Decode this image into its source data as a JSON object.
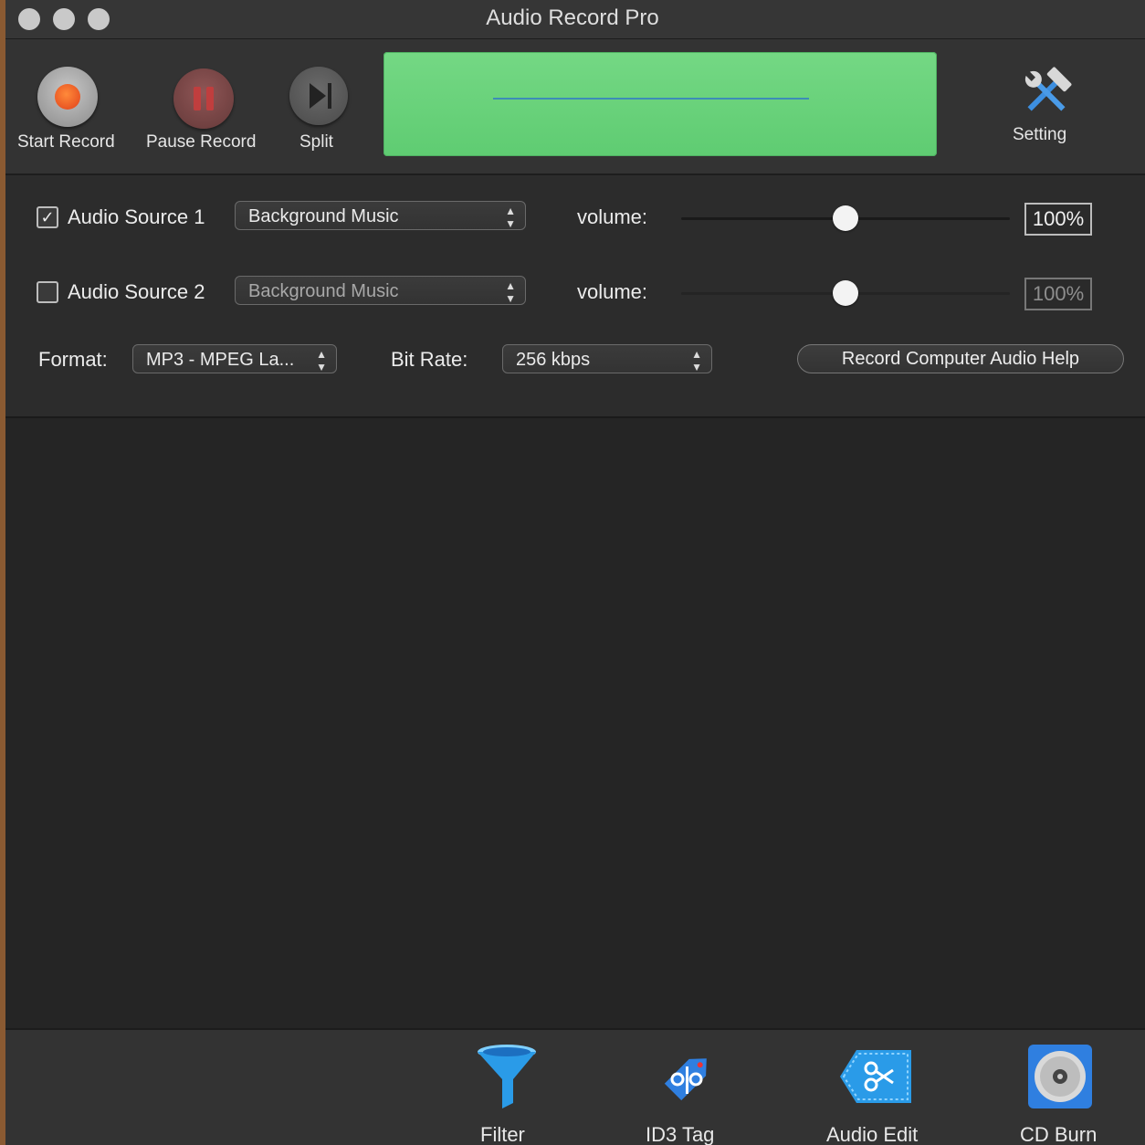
{
  "window": {
    "title": "Audio Record Pro"
  },
  "toolbar": {
    "start_record": "Start Record",
    "pause_record": "Pause Record",
    "split": "Split",
    "setting": "Setting"
  },
  "sources": [
    {
      "checked": true,
      "label": "Audio Source 1",
      "device": "Background Music",
      "volume_label": "volume:",
      "volume_value": "100%",
      "volume_level": 0.5,
      "enabled": true
    },
    {
      "checked": false,
      "label": "Audio Source 2",
      "device": "Background Music",
      "volume_label": "volume:",
      "volume_value": "100%",
      "volume_level": 0.5,
      "enabled": false
    }
  ],
  "format": {
    "label": "Format:",
    "value": "MP3 - MPEG La...",
    "bitrate_label": "Bit Rate:",
    "bitrate_value": "256 kbps",
    "help_button": "Record Computer Audio Help"
  },
  "bottom_tools": {
    "filter": "Filter",
    "id3": "ID3 Tag",
    "audio_edit": "Audio Edit",
    "cd_burn": "CD Burn"
  },
  "icons": {
    "close": "traffic-light-icon",
    "record": "record-icon",
    "pause": "pause-icon",
    "split": "skip-forward-icon",
    "setting": "hammer-wrench-icon",
    "filter": "funnel-icon",
    "id3": "tag-icon",
    "audio_edit": "scissors-icon",
    "cd_burn": "cd-icon"
  },
  "colors": {
    "meter": "#66d27a",
    "record_red": "#e84a1a",
    "accent_blue": "#2f7fe0"
  }
}
